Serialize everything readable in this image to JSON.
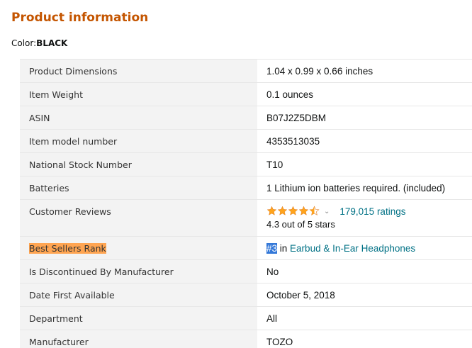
{
  "heading": "Product information",
  "color": {
    "label": "Color:",
    "value": "BLACK"
  },
  "rows": [
    {
      "label": "Product Dimensions",
      "value": "1.04 x 0.99 x 0.66 inches"
    },
    {
      "label": "Item Weight",
      "value": "0.1 ounces"
    },
    {
      "label": "ASIN",
      "value": "B07J2Z5DBM"
    },
    {
      "label": "Item model number",
      "value": "4353513035"
    },
    {
      "label": "National Stock Number",
      "value": "T10"
    },
    {
      "label": "Batteries",
      "value": "1 Lithium ion batteries required. (included)"
    },
    {
      "label": "Customer Reviews",
      "ratings_count": "179,015 ratings",
      "rating_text": "4.3 out of 5 stars",
      "rating": 4.3,
      "star_icons": [
        "star-full-icon",
        "star-full-icon",
        "star-full-icon",
        "star-full-icon",
        "star-half-icon"
      ]
    },
    {
      "label": "Best Sellers Rank",
      "rank": "#3",
      "rank_in": " in ",
      "rank_category": "Earbud & In-Ear Headphones"
    },
    {
      "label": "Is Discontinued By Manufacturer",
      "value": "No"
    },
    {
      "label": "Date First Available",
      "value": "October 5, 2018"
    },
    {
      "label": "Department",
      "value": "All"
    },
    {
      "label": "Manufacturer",
      "value": "TOZO"
    }
  ],
  "colors": {
    "heading": "#c45500",
    "label_bg": "#f3f3f3",
    "star": "#ffa41c",
    "link": "#007185",
    "highlight_orange": "#ffa552",
    "highlight_blue": "#3478d8"
  }
}
